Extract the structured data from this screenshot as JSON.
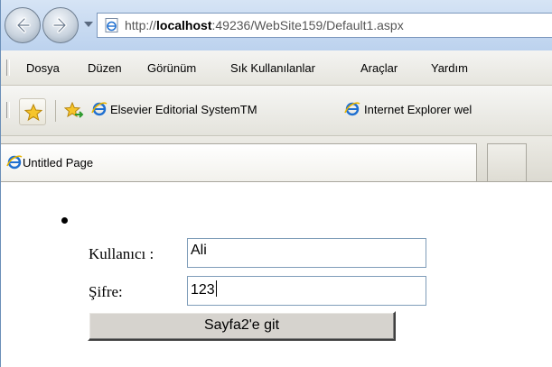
{
  "browser": {
    "url_prefix": "http://",
    "url_host": "localhost",
    "url_rest": ":49236/WebSite159/Default1.aspx"
  },
  "menu": {
    "items": [
      "Dosya",
      "Düzen",
      "Görünüm",
      "Sık Kullanılanlar",
      "Araçlar",
      "Yardım"
    ]
  },
  "favorites": {
    "links": [
      "Elsevier Editorial SystemTM",
      "Internet Explorer wel"
    ]
  },
  "tab": {
    "title": "Untitled Page"
  },
  "form": {
    "username_label": "Kullanıcı :",
    "username_value": "Ali",
    "password_label": "Şifre:",
    "password_value": "123",
    "submit_label": "Sayfa2'e git"
  },
  "icons": {
    "back": "back-arrow-icon",
    "forward": "forward-arrow-icon",
    "page": "ie-page-icon",
    "favorites": "star-icon",
    "add_favorites": "add-favorites-icon"
  }
}
